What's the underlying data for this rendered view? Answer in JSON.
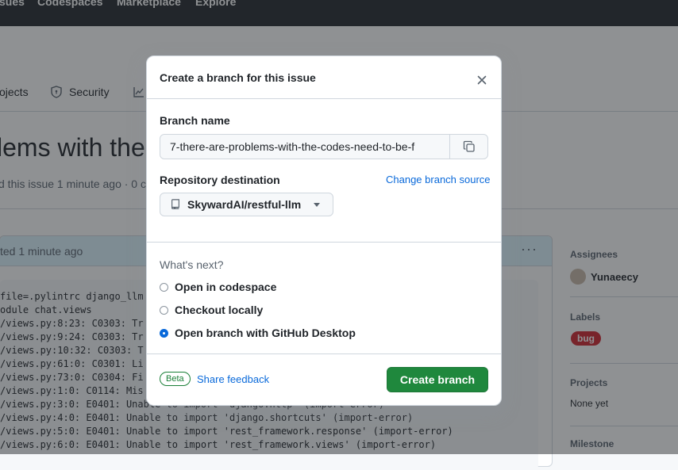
{
  "topnav": {
    "items": [
      "Issues",
      "Codespaces",
      "Marketplace",
      "Explore"
    ],
    "visible_first": "sues"
  },
  "repo_tabs": {
    "projects": "Projects",
    "projects_visible": "ojects",
    "security": "Security"
  },
  "issue": {
    "title_visible": "lems with the",
    "meta_visible": "d this issue 1 minute ago · 0 c"
  },
  "comment": {
    "header_visible": "ted 1 minute ago",
    "code_lines": [
      "file=.pylintrc django_llm",
      "odule chat.views",
      "/views.py:8:23: C0303: Tr",
      "/views.py:9:24: C0303: Tr",
      "/views.py:10:32: C0303: T",
      "/views.py:61:0: C0301: Li",
      "/views.py:73:0: C0304: Fi",
      "/views.py:1:0: C0114: Mis",
      "/views.py:3:0: E0401: Unable to import 'django.http' (import-error)",
      "/views.py:4:0: E0401: Unable to import 'django.shortcuts' (import-error)",
      "/views.py:5:0: E0401: Unable to import 'rest_framework.response' (import-error)",
      "/views.py:6:0: E0401: Unable to import 'rest_framework.views' (import-error)"
    ]
  },
  "sidebar": {
    "assignees_heading": "Assignees",
    "assignee": "Yunaeecy",
    "labels_heading": "Labels",
    "label": "bug",
    "projects_heading": "Projects",
    "projects_value": "None yet",
    "milestone_heading": "Milestone"
  },
  "modal": {
    "title": "Create a branch for this issue",
    "branch_name_label": "Branch name",
    "branch_name_value": "7-there-are-problems-with-the-codes-need-to-be-f",
    "repo_dest_label": "Repository destination",
    "change_source": "Change branch source",
    "repo": "SkywardAI/restful-llm",
    "whats_next": "What's next?",
    "options": [
      {
        "label": "Open in codespace",
        "checked": false
      },
      {
        "label": "Checkout locally",
        "checked": false
      },
      {
        "label": "Open branch with GitHub Desktop",
        "checked": true
      }
    ],
    "beta": "Beta",
    "share_feedback": "Share feedback",
    "create_button": "Create branch"
  },
  "colors": {
    "accent": "#0969da",
    "primary_button": "#1f883d",
    "bug_label": "#d1242f",
    "nav_bg": "#24292f"
  }
}
